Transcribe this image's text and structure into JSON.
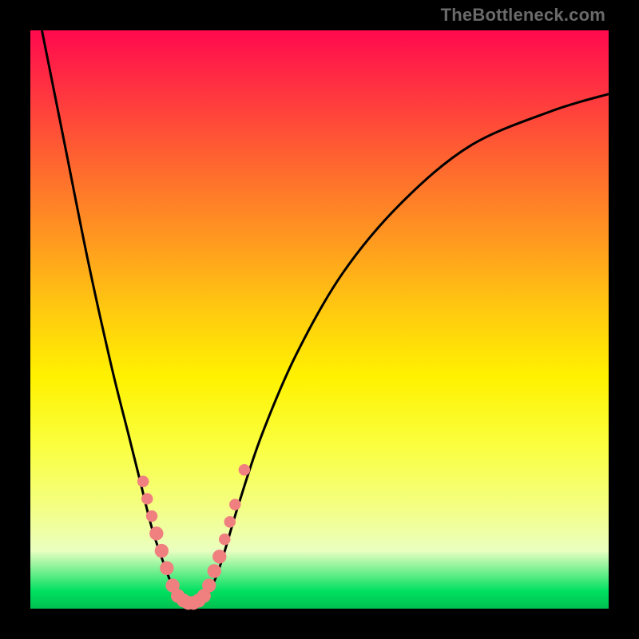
{
  "watermark": "TheBottleneck.com",
  "colors": {
    "background": "#000000",
    "curve": "#000000",
    "marker_fill": "#f08080",
    "marker_stroke": "none",
    "gradient_stops": [
      "#ff0a4e",
      "#ff3a3e",
      "#ff6a2e",
      "#ff9820",
      "#ffc810",
      "#fff200",
      "#faff40",
      "#f4ff80",
      "#eaffc0",
      "#00e060",
      "#00c050"
    ]
  },
  "chart_data": {
    "type": "line",
    "title": "",
    "xlabel": "",
    "ylabel": "",
    "xlim": [
      0,
      100
    ],
    "ylim": [
      0,
      100
    ],
    "grid": false,
    "legend": false,
    "curve": [
      {
        "x": 2,
        "y": 100
      },
      {
        "x": 6,
        "y": 80
      },
      {
        "x": 10,
        "y": 60
      },
      {
        "x": 14,
        "y": 42
      },
      {
        "x": 17,
        "y": 30
      },
      {
        "x": 19,
        "y": 22
      },
      {
        "x": 21,
        "y": 14
      },
      {
        "x": 23,
        "y": 8
      },
      {
        "x": 25,
        "y": 3
      },
      {
        "x": 27,
        "y": 1
      },
      {
        "x": 29,
        "y": 1
      },
      {
        "x": 31,
        "y": 3
      },
      {
        "x": 33,
        "y": 8
      },
      {
        "x": 36,
        "y": 18
      },
      {
        "x": 40,
        "y": 30
      },
      {
        "x": 46,
        "y": 44
      },
      {
        "x": 54,
        "y": 58
      },
      {
        "x": 64,
        "y": 70
      },
      {
        "x": 76,
        "y": 80
      },
      {
        "x": 90,
        "y": 86
      },
      {
        "x": 100,
        "y": 89
      }
    ],
    "markers": [
      {
        "x": 19.5,
        "y": 22,
        "r": 1.0
      },
      {
        "x": 20.2,
        "y": 19,
        "r": 1.0
      },
      {
        "x": 21.0,
        "y": 16,
        "r": 1.0
      },
      {
        "x": 21.8,
        "y": 13,
        "r": 1.2
      },
      {
        "x": 22.7,
        "y": 10,
        "r": 1.2
      },
      {
        "x": 23.6,
        "y": 7,
        "r": 1.2
      },
      {
        "x": 24.6,
        "y": 4,
        "r": 1.2
      },
      {
        "x": 25.5,
        "y": 2.2,
        "r": 1.2
      },
      {
        "x": 26.5,
        "y": 1.4,
        "r": 1.2
      },
      {
        "x": 27.3,
        "y": 1.0,
        "r": 1.2
      },
      {
        "x": 28.2,
        "y": 1.0,
        "r": 1.2
      },
      {
        "x": 29.1,
        "y": 1.4,
        "r": 1.2
      },
      {
        "x": 30.0,
        "y": 2.2,
        "r": 1.2
      },
      {
        "x": 30.9,
        "y": 4.0,
        "r": 1.2
      },
      {
        "x": 31.8,
        "y": 6.5,
        "r": 1.2
      },
      {
        "x": 32.7,
        "y": 9.0,
        "r": 1.2
      },
      {
        "x": 33.6,
        "y": 12,
        "r": 1.0
      },
      {
        "x": 34.5,
        "y": 15,
        "r": 1.0
      },
      {
        "x": 35.4,
        "y": 18,
        "r": 1.0
      },
      {
        "x": 37.0,
        "y": 24,
        "r": 1.0
      }
    ]
  }
}
